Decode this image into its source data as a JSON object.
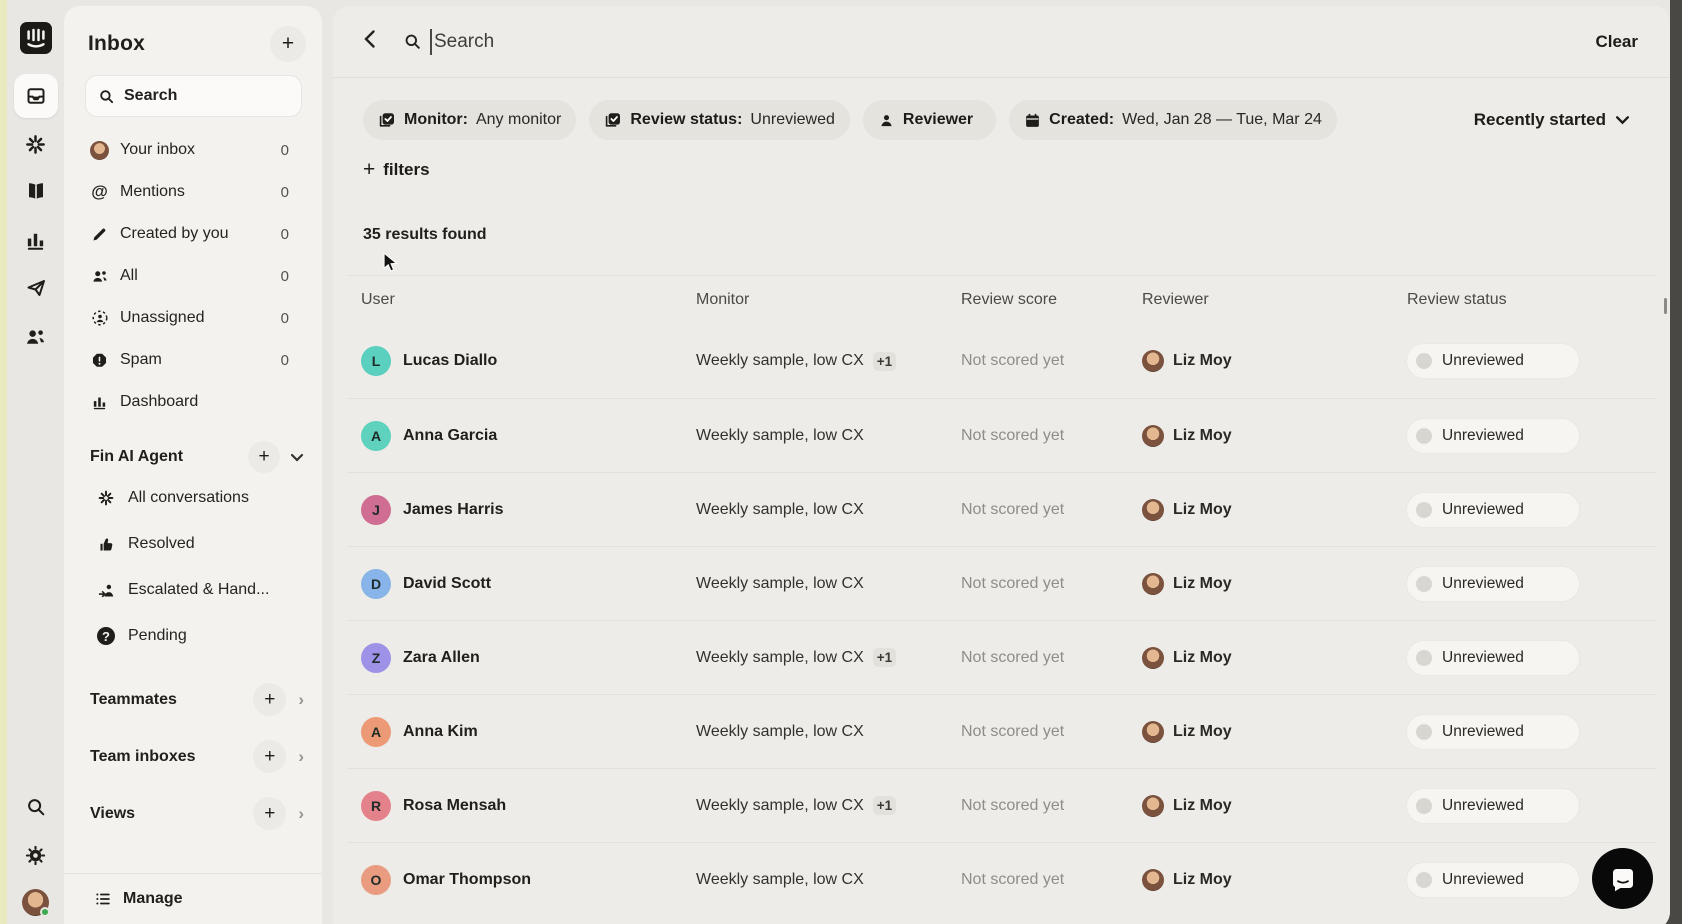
{
  "icon_rail": {
    "items": [
      "intercom-logo",
      "inbox",
      "fin-ai",
      "knowledge",
      "reports",
      "outbound",
      "contacts"
    ],
    "bottom_items": [
      "search",
      "settings",
      "profile"
    ]
  },
  "sidebar": {
    "title": "Inbox",
    "add_label": "+",
    "search_label": "Search",
    "items": [
      {
        "icon": "your-avatar",
        "label": "Your inbox",
        "count": "0"
      },
      {
        "icon": "at",
        "label": "Mentions",
        "count": "0"
      },
      {
        "icon": "pencil",
        "label": "Created by you",
        "count": "0"
      },
      {
        "icon": "people",
        "label": "All",
        "count": "0"
      },
      {
        "icon": "unassigned",
        "label": "Unassigned",
        "count": "0"
      },
      {
        "icon": "spam",
        "label": "Spam",
        "count": "0"
      },
      {
        "icon": "dashboard",
        "label": "Dashboard",
        "count": ""
      }
    ],
    "fin_section": {
      "title": "Fin AI Agent",
      "add_label": "+",
      "items": [
        {
          "icon": "fin-spark",
          "label": "All conversations"
        },
        {
          "icon": "thumb-up",
          "label": "Resolved"
        },
        {
          "icon": "escalated",
          "label": "Escalated & Hand..."
        },
        {
          "icon": "pending",
          "label": "Pending"
        }
      ]
    },
    "groups": [
      {
        "label": "Teammates",
        "add_label": "+"
      },
      {
        "label": "Team inboxes",
        "add_label": "+"
      },
      {
        "label": "Views",
        "add_label": "+"
      }
    ],
    "manage_label": "Manage"
  },
  "header": {
    "search_placeholder": "Search",
    "clear_label": "Clear"
  },
  "filters": {
    "chips": [
      {
        "icon": "monitor-check",
        "label": "Monitor:",
        "value": "Any monitor"
      },
      {
        "icon": "monitor-check",
        "label": "Review status:",
        "value": "Unreviewed"
      },
      {
        "icon": "person",
        "label": "Reviewer",
        "value": ""
      },
      {
        "icon": "calendar",
        "label": "Created:",
        "value": "Wed, Jan 28 — Tue, Mar 24"
      }
    ],
    "sort_label": "Recently started",
    "add_filters_label": "filters",
    "add_filters_plus": "+"
  },
  "results_summary": "35 results found",
  "table": {
    "columns": [
      "User",
      "Monitor",
      "Review score",
      "Reviewer",
      "Review status"
    ],
    "rows": [
      {
        "initial": "L",
        "avatar_color": "#5bd0bf",
        "name": "Lucas Diallo",
        "monitor": "Weekly sample, low CX",
        "extra": "+1",
        "score": "Not scored yet",
        "reviewer": "Liz Moy",
        "status": "Unreviewed"
      },
      {
        "initial": "A",
        "avatar_color": "#5ed2bd",
        "name": "Anna Garcia",
        "monitor": "Weekly sample, low CX",
        "extra": "",
        "score": "Not scored yet",
        "reviewer": "Liz Moy",
        "status": "Unreviewed"
      },
      {
        "initial": "J",
        "avatar_color": "#cf6d92",
        "name": "James Harris",
        "monitor": "Weekly sample, low CX",
        "extra": "",
        "score": "Not scored yet",
        "reviewer": "Liz Moy",
        "status": "Unreviewed"
      },
      {
        "initial": "D",
        "avatar_color": "#89b4ea",
        "name": "David Scott",
        "monitor": "Weekly sample, low CX",
        "extra": "",
        "score": "Not scored yet",
        "reviewer": "Liz Moy",
        "status": "Unreviewed"
      },
      {
        "initial": "Z",
        "avatar_color": "#9d92e8",
        "name": "Zara Allen",
        "monitor": "Weekly sample, low CX",
        "extra": "+1",
        "score": "Not scored yet",
        "reviewer": "Liz Moy",
        "status": "Unreviewed"
      },
      {
        "initial": "A",
        "avatar_color": "#ec9a75",
        "name": "Anna Kim",
        "monitor": "Weekly sample, low CX",
        "extra": "",
        "score": "Not scored yet",
        "reviewer": "Liz Moy",
        "status": "Unreviewed"
      },
      {
        "initial": "R",
        "avatar_color": "#e4828b",
        "name": "Rosa Mensah",
        "monitor": "Weekly sample, low CX",
        "extra": "+1",
        "score": "Not scored yet",
        "reviewer": "Liz Moy",
        "status": "Unreviewed"
      },
      {
        "initial": "O",
        "avatar_color": "#ea9c80",
        "name": "Omar Thompson",
        "monitor": "Weekly sample, low CX",
        "extra": "",
        "score": "Not scored yet",
        "reviewer": "Liz Moy",
        "status": "Unreviewed"
      }
    ]
  },
  "colors": {
    "app_background": "#e8e7e3",
    "sidebar_background": "#f3f2ee",
    "panel_background": "#edece8",
    "chip_background": "#e4e3de",
    "pill_background": "#f6f5f2",
    "status_dot": "#d8d6d1",
    "presence_green": "#3aa94f",
    "launcher_black": "#090909"
  }
}
